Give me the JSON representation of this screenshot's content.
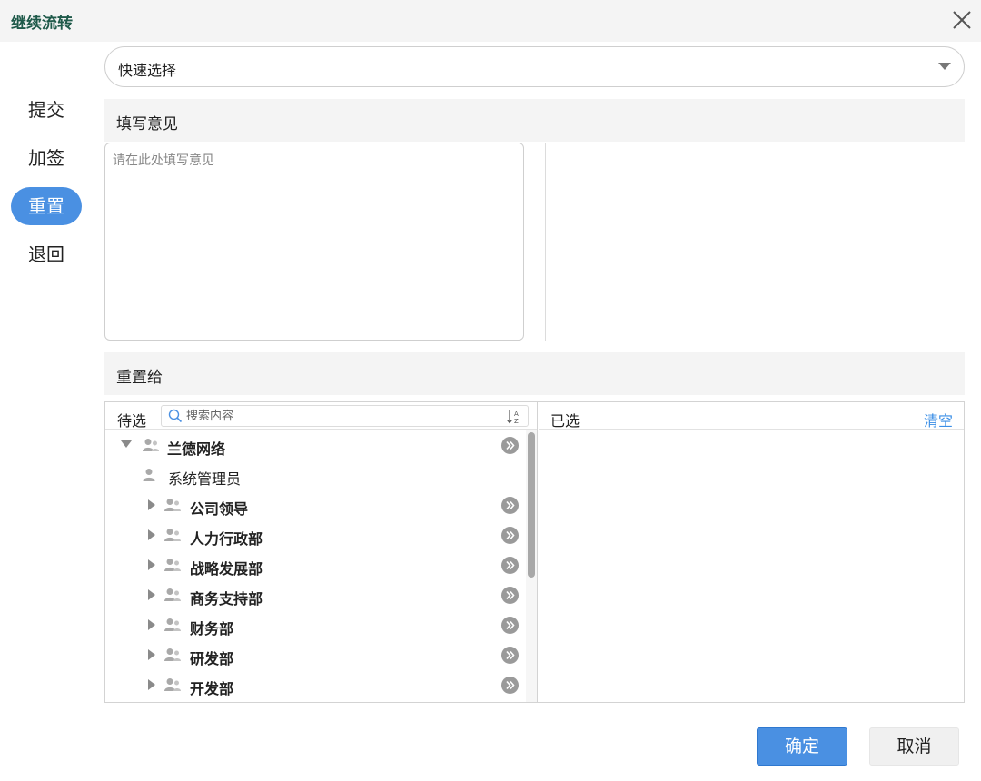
{
  "dialog": {
    "title": "继续流转"
  },
  "sidebar": {
    "items": [
      {
        "label": "提交",
        "active": false
      },
      {
        "label": "加签",
        "active": false
      },
      {
        "label": "重置",
        "active": true
      },
      {
        "label": "退回",
        "active": false
      }
    ]
  },
  "quick_select": {
    "value": "快速选择"
  },
  "opinion": {
    "header": "填写意见",
    "placeholder": "请在此处填写意见",
    "value": ""
  },
  "reassign": {
    "header": "重置给",
    "candidates_label": "待选",
    "search_placeholder": "搜索内容",
    "selected_label": "已选",
    "clear_label": "清空",
    "tree": [
      {
        "label": "兰德网络",
        "type": "group",
        "expanded": true
      },
      {
        "label": "系统管理员",
        "type": "user"
      },
      {
        "label": "公司领导",
        "type": "group",
        "expanded": false
      },
      {
        "label": "人力行政部",
        "type": "group",
        "expanded": false
      },
      {
        "label": "战略发展部",
        "type": "group",
        "expanded": false
      },
      {
        "label": "商务支持部",
        "type": "group",
        "expanded": false
      },
      {
        "label": "财务部",
        "type": "group",
        "expanded": false
      },
      {
        "label": "研发部",
        "type": "group",
        "expanded": false
      },
      {
        "label": "开发部",
        "type": "group",
        "expanded": false
      }
    ],
    "selected": []
  },
  "footer": {
    "ok_label": "确定",
    "cancel_label": "取消"
  },
  "colors": {
    "accent": "#4a90e2",
    "title": "#1f5a4a",
    "link": "#3a8ee6",
    "header_bg": "#f4f4f4"
  }
}
